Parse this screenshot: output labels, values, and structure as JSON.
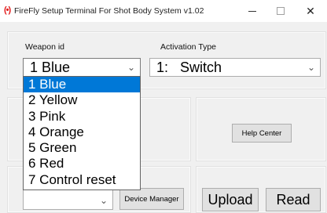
{
  "window": {
    "app_icon_glyph": "(•)",
    "title": "FireFly Setup Terminal For Shot Body System  v1.02",
    "minimize_glyph": "",
    "close_glyph": "✕"
  },
  "weapon": {
    "label": "Weapon id",
    "selected": "1 Blue",
    "options": [
      "1 Blue",
      "2 Yellow",
      "3 Pink",
      "4 Orange",
      "5 Green",
      "6 Red",
      "7 Control reset"
    ]
  },
  "activation": {
    "label": "Activation Type",
    "selected": "1:   Switch"
  },
  "buttons": {
    "help_center": "Help Center",
    "device_manager": "Device Manager",
    "upload": "Upload",
    "read": "Read"
  },
  "icons": {
    "chevron": "⌄"
  },
  "colors": {
    "selection": "#0078d7",
    "app_icon": "#e21b1b"
  }
}
